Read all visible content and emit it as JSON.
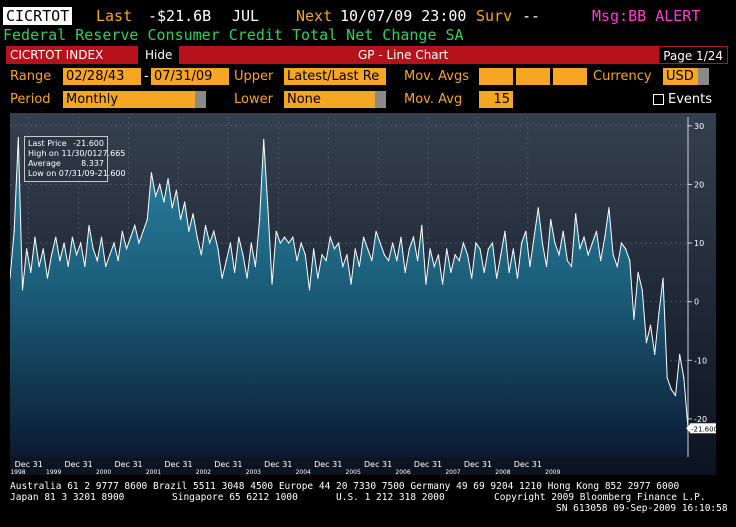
{
  "header": {
    "ticker": "CICRTOT",
    "last_label": "Last",
    "last_value": "-$21.6B",
    "last_period": "JUL",
    "next_label": "Next",
    "next_date": "10/07/09 23:00",
    "surv_label": "Surv",
    "surv_value": "--",
    "alert": "Msg:BB ALERT",
    "subtitle": "Federal Reserve Consumer Credit Total Net Change SA"
  },
  "toolbar": {
    "index_label": "CICRTOT INDEX",
    "hide_label": "Hide",
    "title": "GP - Line Chart",
    "page": "Page 1/24"
  },
  "controls": {
    "range_label": "Range",
    "range_start": "02/28/43",
    "range_dash": "-",
    "range_end": "07/31/09",
    "upper_label": "Upper",
    "upper_value": "Latest/Last Re",
    "movavgs_label": "Mov. Avgs",
    "currency_label": "Currency",
    "currency_value": "USD",
    "period_label": "Period",
    "period_value": "Monthly",
    "lower_label": "Lower",
    "lower_value": "None",
    "movavg_label": "Mov. Avg",
    "movavg_value": "15",
    "events_label": "Events"
  },
  "legend": {
    "rows": [
      {
        "label": "Last Price",
        "value": "-21.600"
      },
      {
        "label": "High on 11/30/01",
        "value": "27.665"
      },
      {
        "label": "Average",
        "value": "8.337"
      },
      {
        "label": "Low on 07/31/09",
        "value": "-21.600"
      }
    ]
  },
  "chart_data": {
    "type": "area",
    "title": "",
    "xlabel": "",
    "ylabel": "",
    "ylim": [
      -26.5,
      31.5
    ],
    "yticks": [
      30,
      20,
      10,
      0,
      -10,
      -20
    ],
    "y_tick_labels": [
      "30",
      "20",
      "10",
      "0",
      "-10",
      "-20"
    ],
    "x_major_labels": [
      "Dec 31",
      "Dec 31",
      "Dec 31",
      "Dec 31",
      "Dec 31",
      "Dec 31",
      "Dec 31",
      "Dec 31",
      "Dec 31",
      "Dec 31",
      "Dec 31"
    ],
    "x_year_labels": [
      "1998",
      "1999",
      "2000",
      "2001",
      "2002",
      "2003",
      "2004",
      "2005",
      "2006",
      "2007",
      "2008",
      "2009"
    ],
    "last_value_label": "-21.600",
    "grid": true,
    "fill_color": "#1f6e8a",
    "line_color": "#ffffff",
    "x_start": "1997-08",
    "x_end": "2009-07",
    "values": [
      4,
      12,
      28,
      2,
      9,
      5,
      11,
      6,
      9,
      4,
      8,
      11,
      7,
      10,
      6,
      11,
      8,
      10,
      6,
      13,
      9,
      7,
      11,
      6,
      8,
      10,
      7,
      12,
      9,
      11,
      13,
      10,
      12,
      14,
      22,
      18,
      20,
      17,
      21,
      16,
      19,
      14,
      17,
      12,
      15,
      11,
      8,
      13,
      10,
      12,
      9,
      4,
      7,
      10,
      5,
      11,
      8,
      4,
      10,
      6,
      14,
      27.665,
      16,
      3,
      12,
      10,
      11,
      10,
      11,
      7,
      10,
      8,
      2,
      9,
      4,
      8,
      7,
      11,
      9,
      10,
      6,
      8,
      3,
      9,
      6,
      11,
      9,
      7,
      12,
      10,
      8,
      7,
      10,
      7,
      11,
      5,
      9,
      11,
      7,
      13,
      3,
      9,
      6,
      8,
      3,
      9,
      5,
      8,
      7,
      10,
      8,
      4,
      10,
      9,
      5,
      9,
      10,
      4,
      8,
      12,
      5,
      9,
      4,
      10,
      12,
      6,
      11,
      16,
      10,
      6,
      14,
      10,
      8,
      12,
      7,
      6,
      15,
      9,
      11,
      8,
      10,
      12,
      7,
      11,
      16,
      8,
      6,
      10,
      9,
      7,
      -3,
      5,
      2,
      -7,
      -4,
      -9,
      -2,
      4,
      -13,
      -15,
      -16,
      -9,
      -13,
      -21.6
    ]
  },
  "footer": {
    "line1": "Australia 61 2 9777 8600 Brazil 5511 3048 4500 Europe 44 20 7330 7500 Germany 49 69 9204 1210 Hong Kong 852 2977 6000",
    "line2_left": "Japan 81 3 3201 8900",
    "line2_mid1": "Singapore 65 6212 1000",
    "line2_mid2": "U.S. 1 212 318 2000",
    "line2_right": "Copyright 2009 Bloomberg Finance L.P.",
    "line3": "SN 613058 09-Sep-2009 16:10:58"
  }
}
